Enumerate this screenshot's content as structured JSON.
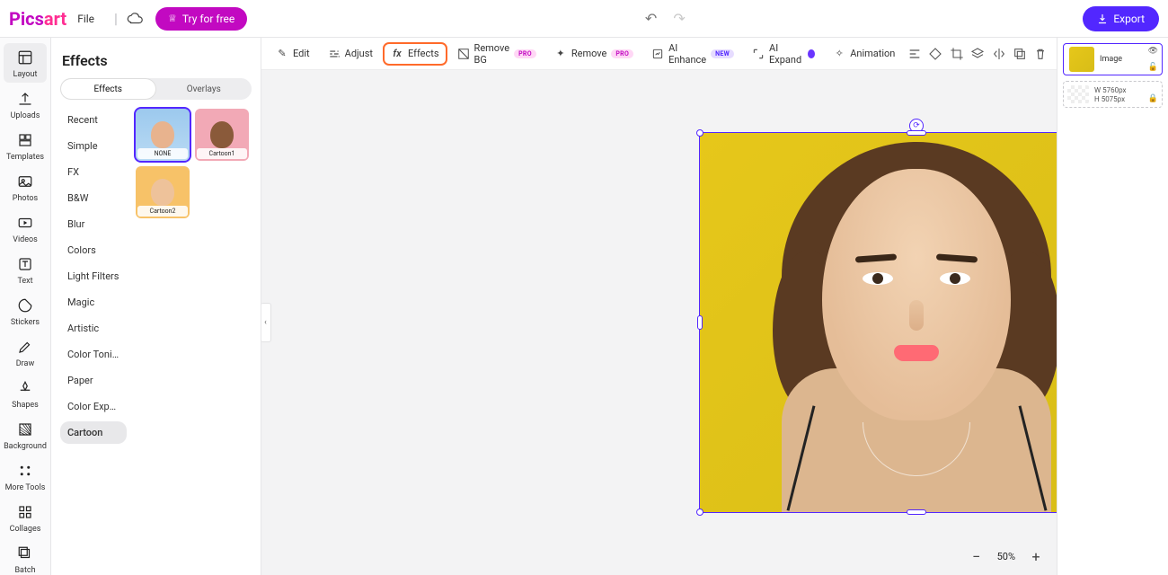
{
  "brand": {
    "part1": "Pics",
    "part2": "art"
  },
  "topbar": {
    "file": "File",
    "try_free": "Try for free",
    "export": "Export"
  },
  "vnav": [
    {
      "label": "Layout"
    },
    {
      "label": "Uploads"
    },
    {
      "label": "Templates"
    },
    {
      "label": "Photos"
    },
    {
      "label": "Videos"
    },
    {
      "label": "Text"
    },
    {
      "label": "Stickers"
    },
    {
      "label": "Draw"
    },
    {
      "label": "Shapes"
    },
    {
      "label": "Background"
    },
    {
      "label": "More Tools"
    },
    {
      "label": "Collages"
    },
    {
      "label": "Batch"
    }
  ],
  "sidepanel": {
    "title": "Effects",
    "tabs": {
      "effects": "Effects",
      "overlays": "Overlays"
    },
    "categories": [
      "Recent",
      "Simple",
      "FX",
      "B&W",
      "Blur",
      "Colors",
      "Light Filters",
      "Magic",
      "Artistic",
      "Color Toning",
      "Paper",
      "Color Expos...",
      "Cartoon"
    ],
    "active_category_index": 12,
    "thumbs": [
      {
        "label": "NONE"
      },
      {
        "label": "Cartoon1"
      },
      {
        "label": "Cartoon2"
      }
    ],
    "selected_thumb_index": 0
  },
  "ctxbar": {
    "edit": "Edit",
    "adjust": "Adjust",
    "effects": "Effects",
    "remove_bg": "Remove BG",
    "remove": "Remove",
    "ai_enhance": "AI Enhance",
    "ai_expand": "AI Expand",
    "animation": "Animation",
    "badge_pro": "PRO",
    "badge_new": "NEW"
  },
  "layers": {
    "image_label": "Image",
    "bg": {
      "w": "W  5760px",
      "h": "H  5075px"
    }
  },
  "zoom": {
    "value": "50%"
  },
  "colors": {
    "accent": "#5227ff",
    "brand": "#c209c1",
    "highlight": "#ff6a2a"
  }
}
